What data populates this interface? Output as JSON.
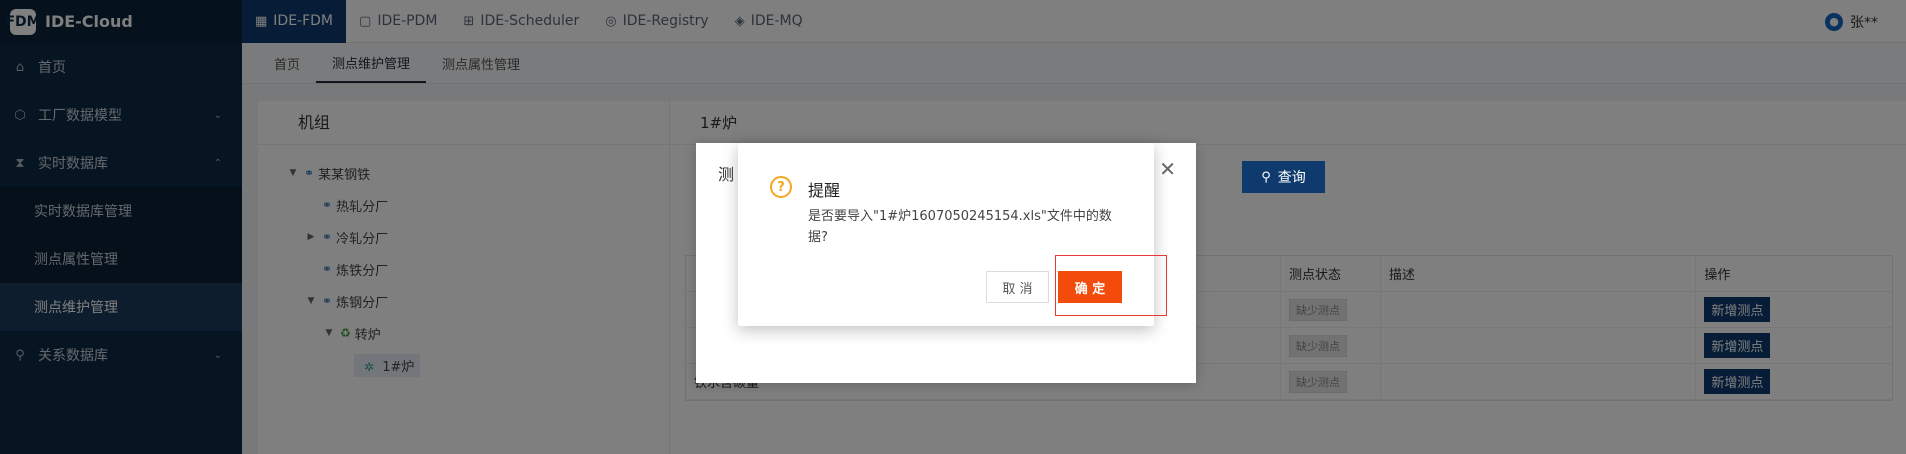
{
  "app": {
    "brand_logo": "FDM",
    "brand": "IDE-Cloud"
  },
  "sidebar": {
    "items": [
      {
        "label": "首页",
        "icon": "home-icon"
      },
      {
        "label": "工厂数据模型",
        "icon": "cube-icon",
        "arrow": "chevron-down"
      },
      {
        "label": "实时数据库",
        "icon": "hourglass-icon",
        "arrow": "chevron-up"
      },
      {
        "label": "实时数据库管理"
      },
      {
        "label": "测点属性管理"
      },
      {
        "label": "测点维护管理",
        "active": true
      },
      {
        "label": "关系数据库",
        "icon": "link-icon",
        "arrow": "chevron-down"
      }
    ]
  },
  "topnav": {
    "tabs": [
      {
        "label": "IDE-FDM",
        "icon": "grid-icon",
        "active": true
      },
      {
        "label": "IDE-PDM",
        "icon": "bag-icon"
      },
      {
        "label": "IDE-Scheduler",
        "icon": "hierarchy-icon"
      },
      {
        "label": "IDE-Registry",
        "icon": "registry-icon"
      },
      {
        "label": "IDE-MQ",
        "icon": "box-icon"
      }
    ],
    "user": "张**"
  },
  "breadcrumbs": [
    {
      "label": "首页"
    },
    {
      "label": "测点维护管理",
      "active": true
    },
    {
      "label": "测点属性管理"
    }
  ],
  "left_panel": {
    "title": "机组",
    "tree": [
      {
        "label": "某某钢铁"
      },
      {
        "label": "热轧分厂"
      },
      {
        "label": "冷轧分厂"
      },
      {
        "label": "炼铁分厂"
      },
      {
        "label": "炼钢分厂"
      },
      {
        "label": "转炉"
      },
      {
        "label": "1#炉"
      }
    ]
  },
  "right_panel": {
    "title": "1#炉",
    "query_button": "查询",
    "table": {
      "headers": [
        "",
        "测点状态",
        "描述",
        "操作"
      ],
      "rows": [
        {
          "name": "",
          "status": "缺少测点",
          "desc": "",
          "action": "新增测点"
        },
        {
          "name": "",
          "status": "缺少测点",
          "desc": "",
          "action": "新增测点"
        },
        {
          "name": "铁水含碳量",
          "status": "缺少测点",
          "desc": "",
          "action": "新增测点"
        }
      ]
    }
  },
  "bg_dialog": {
    "title_partial": "测"
  },
  "confirm": {
    "title": "提醒",
    "message": "是否要导入\"1#炉1607050245154.xls\"文件中的数据?",
    "cancel": "取 消",
    "ok": "确 定",
    "warn_color": "#f5a623",
    "ok_color": "#f24b0c"
  }
}
